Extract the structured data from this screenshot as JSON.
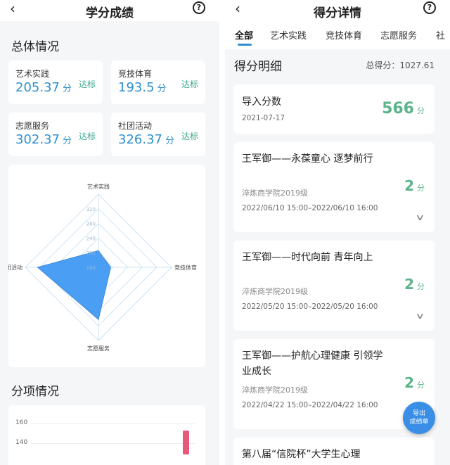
{
  "left": {
    "header": {
      "back": "‹",
      "title": "学分成绩",
      "help": "?"
    },
    "overview_title": "总体情况",
    "stats": [
      {
        "name": "艺术实践",
        "value": "205.37",
        "unit": "分",
        "badge": "达标"
      },
      {
        "name": "竞技体育",
        "value": "193.5",
        "unit": "分",
        "badge": "达标"
      },
      {
        "name": "志愿服务",
        "value": "302.37",
        "unit": "分",
        "badge": "达标"
      },
      {
        "name": "社团活动",
        "value": "326.37",
        "unit": "分",
        "badge": "达标"
      }
    ],
    "radar": {
      "axes": [
        "艺术实践",
        "竞技体育",
        "志愿服务",
        "社团活动"
      ],
      "ticks": [
        "160",
        "200",
        "240",
        "280",
        "320"
      ],
      "fill_color": "#4a9ff5"
    },
    "breakdown_title": "分项情况",
    "bar_ticks": [
      "160",
      "140"
    ],
    "bar_color": "#e8577c"
  },
  "right": {
    "header": {
      "back": "‹",
      "title": "得分详情",
      "help": "?"
    },
    "tabs": [
      "全部",
      "艺术实践",
      "竞技体育",
      "志愿服务",
      "社"
    ],
    "detail_title": "得分明细",
    "total_label": "总得分：1027.61",
    "import_entry": {
      "title": "导入分数",
      "date": "2021-07-17",
      "points": "566",
      "unit": "分"
    },
    "entries": [
      {
        "title": "王军御——永葆童心 逐梦前行",
        "org": "淬炼商学院2019级",
        "time": "2022/06/10 15:00–2022/06/10 16:00",
        "points": "2",
        "unit": "分"
      },
      {
        "title": "王军御——时代向前 青年向上",
        "org": "淬炼商学院2019级",
        "time": "2022/05/20 15:00–2022/05/20 16:00",
        "points": "2",
        "unit": "分"
      },
      {
        "title": "王军御——护航心理健康 引领学业成长",
        "org": "淬炼商学院2019级",
        "time": "2022/04/22 15:00–2022/04/22 16:00",
        "points": "2",
        "unit": "分"
      },
      {
        "title": "第八届“信院杯”大学生心理"
      }
    ],
    "fab": {
      "line1": "导出",
      "line2": "成绩单"
    },
    "accent": "#2f8fd0",
    "points_color": "#5cb48a"
  },
  "chart_data": {
    "type": "radar",
    "categories": [
      "艺术实践",
      "竞技体育",
      "志愿服务",
      "社团活动"
    ],
    "values": [
      205.37,
      193.5,
      302.37,
      326.37
    ],
    "ticks": [
      160,
      200,
      240,
      280,
      320
    ],
    "range": [
      160,
      360
    ]
  }
}
